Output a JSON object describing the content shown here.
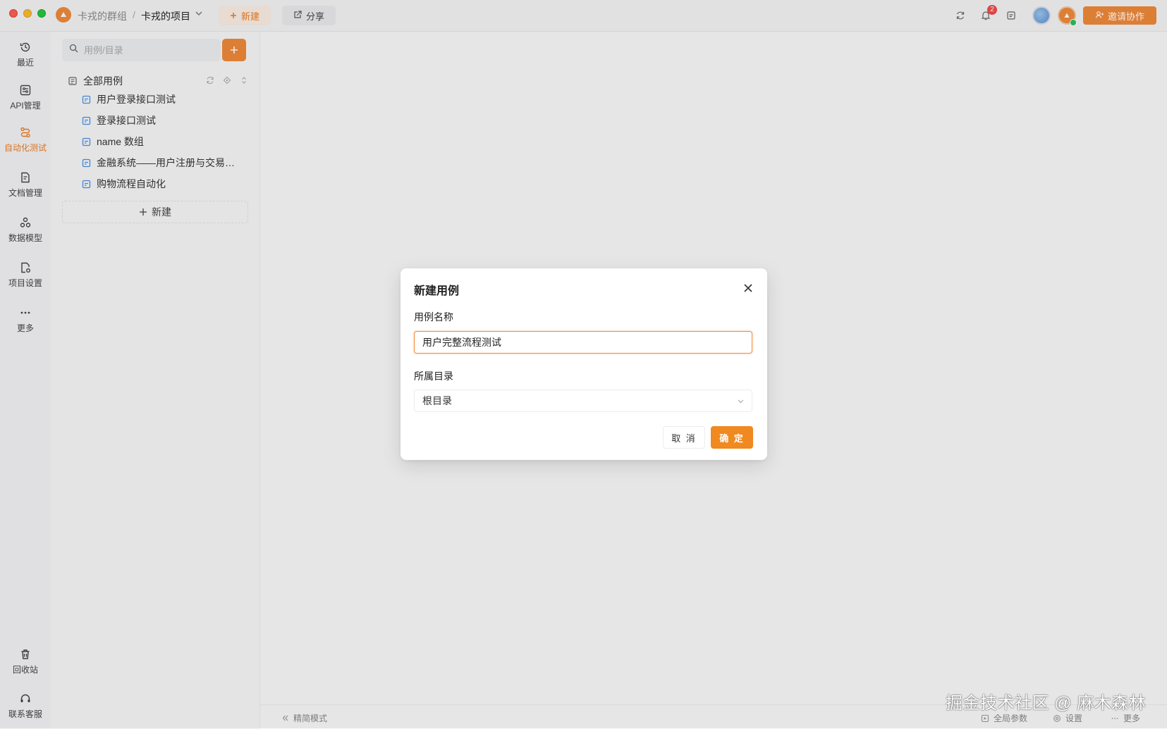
{
  "window": {
    "group": "卡戎的群组",
    "separator": "/",
    "project": "卡戎的项目",
    "new_label": "新建",
    "share_label": "分享",
    "notification_count": "2",
    "invite_label": "邀请协作"
  },
  "rail": {
    "recent": "最近",
    "api": "API管理",
    "automation": "自动化测试",
    "docs": "文档管理",
    "data_model": "数据模型",
    "project_settings": "项目设置",
    "more": "更多",
    "trash": "回收站",
    "support": "联系客服"
  },
  "tree": {
    "search_placeholder": "用例/目录",
    "root_label": "全部用例",
    "items": [
      {
        "label": "用户登录接口测试"
      },
      {
        "label": "登录接口测试"
      },
      {
        "label": "name 数组"
      },
      {
        "label": "金融系统——用户注册与交易验证"
      },
      {
        "label": "购物流程自动化"
      }
    ],
    "new_label": "新建"
  },
  "bottombar": {
    "compact_mode": "精简模式",
    "global_params": "全局参数",
    "settings": "设置",
    "more": "更多"
  },
  "watermark": "掘金技术社区 @ 麻木森林",
  "modal": {
    "title": "新建用例",
    "name_label": "用例名称",
    "name_value": "用户完整流程测试",
    "dir_label": "所属目录",
    "dir_value": "根目录",
    "cancel": "取 消",
    "ok": "确 定"
  },
  "colors": {
    "accent": "#f0893a",
    "active_nav": "#ee7d22",
    "badge": "#f04d4d",
    "tree_icon": "#4a90e2"
  }
}
